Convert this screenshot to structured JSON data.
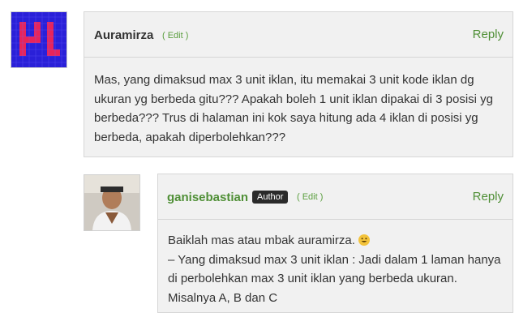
{
  "comments": [
    {
      "author": "Auramirza",
      "edit": "( Edit )",
      "reply": "Reply",
      "body": "Mas, yang dimaksud max 3 unit iklan, itu memakai 3 unit kode iklan dg ukuran yg berbeda gitu??? Apakah boleh 1 unit iklan dipakai di 3 posisi yg berbeda??? Trus di halaman ini kok saya hitung ada 4 iklan di posisi yg berbeda, apakah diperbolehkan???"
    },
    {
      "author": "ganisebastian",
      "badge": "Author",
      "edit": "( Edit )",
      "reply": "Reply",
      "line1": "Baiklah mas atau mbak auramirza.",
      "body": "– Yang dimaksud max 3 unit iklan : Jadi dalam 1 laman hanya di perbolehkan max 3 unit iklan yang berbeda ukuran. Misalnya A, B dan C"
    }
  ],
  "colors": {
    "link_green": "#4f8f36",
    "avatar_blue": "#2a20d8",
    "avatar_red": "#e8245a"
  },
  "icons": [
    "identicon-avatar",
    "user-photo-avatar",
    "smile-emoji-icon"
  ]
}
